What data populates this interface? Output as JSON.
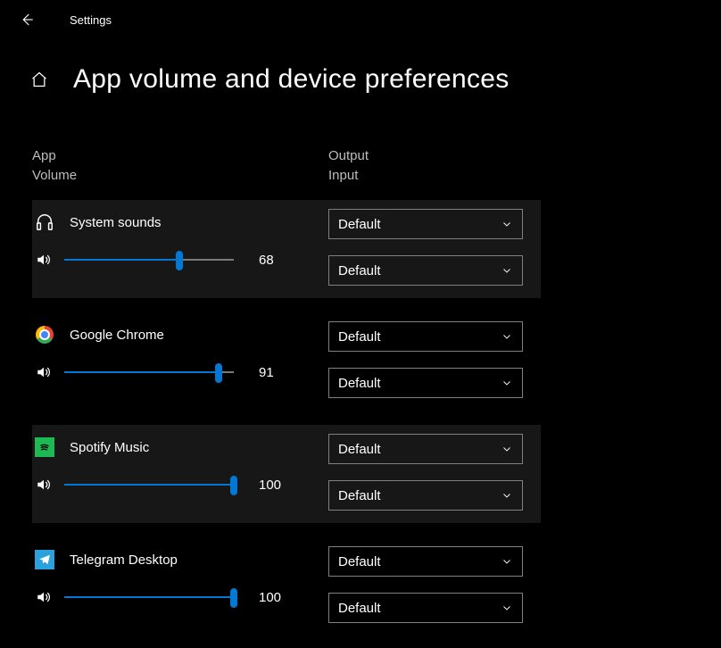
{
  "topbar": {
    "settings_label": "Settings"
  },
  "page": {
    "title": "App volume and device preferences"
  },
  "columns": {
    "left_line1": "App",
    "left_line2": "Volume",
    "right_line1": "Output",
    "right_line2": "Input"
  },
  "apps": [
    {
      "icon": "headphones",
      "name": "System sounds",
      "volume": 68,
      "output": "Default",
      "input": "Default",
      "alt": true
    },
    {
      "icon": "chrome",
      "name": "Google Chrome",
      "volume": 91,
      "output": "Default",
      "input": "Default",
      "alt": false
    },
    {
      "icon": "spotify",
      "name": "Spotify Music",
      "volume": 100,
      "output": "Default",
      "input": "Default",
      "alt": true
    },
    {
      "icon": "telegram",
      "name": "Telegram Desktop",
      "volume": 100,
      "output": "Default",
      "input": "Default",
      "alt": false
    }
  ]
}
